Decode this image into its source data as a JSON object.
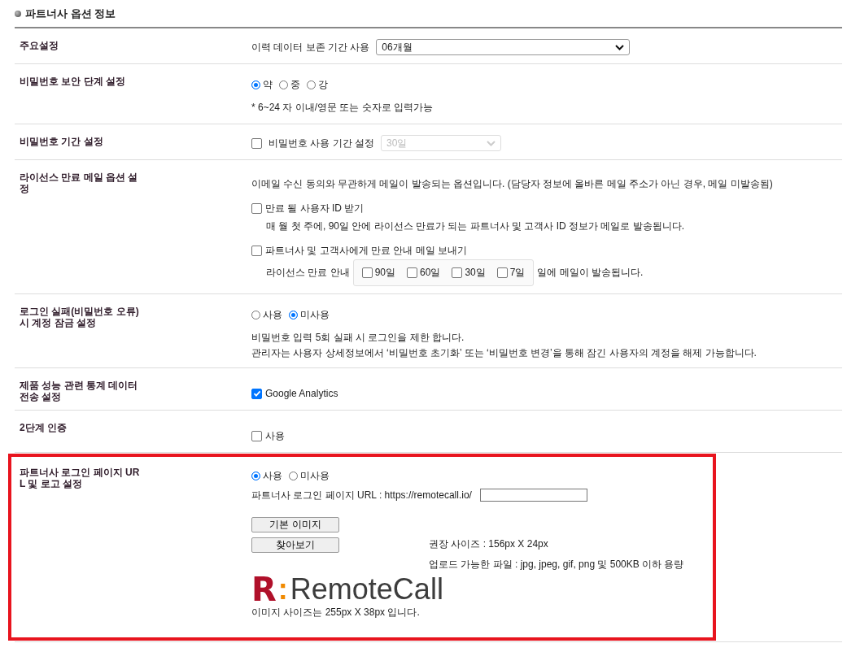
{
  "section_title": "파트너사 옵션 정보",
  "rows": [
    {
      "label": "주요설정",
      "highlighted": false,
      "items": [
        {
          "kind": "select",
          "text": "이력 데이터 보존 기간 사용",
          "value": "06개월",
          "disabled": false
        }
      ]
    },
    {
      "label": "비밀번호 보안 단계 설정",
      "highlighted": false,
      "items": [
        {
          "kind": "radios",
          "options": [
            {
              "label": "약",
              "selected": true
            },
            {
              "label": "중",
              "selected": false
            },
            {
              "label": "강",
              "selected": false
            }
          ]
        },
        {
          "kind": "note",
          "text": "* 6~24 자 이내/영문 또는 숫자로 입력가능"
        }
      ]
    },
    {
      "label": "비밀번호 기간 설정",
      "highlighted": false,
      "items": [
        {
          "kind": "check-select",
          "checked": false,
          "text": "비밀번호 사용 기간 설정",
          "value": "30일",
          "disabled": true
        }
      ]
    },
    {
      "label": "라이선스 만료 메일 옵션 설정",
      "highlighted": false,
      "items": [
        {
          "kind": "note",
          "text": "이메일 수신 동의와 무관하게 메일이 발송되는 옵션입니다. (담당자 정보에 올바른 메일 주소가 아닌 경우, 메일 미발송됨)"
        },
        {
          "kind": "check",
          "checked": false,
          "text": "만료 될 사용자 ID 받기"
        },
        {
          "kind": "subnote",
          "text": "매 월 첫 주에, 90일 안에 라이선스 만료가 되는 파트너사 및 고객사 ID 정보가 메일로 발송됩니다."
        },
        {
          "kind": "check",
          "checked": false,
          "text": "파트너사 및 고객사에게 만료 안내 메일 보내기"
        },
        {
          "kind": "day-checks",
          "text": "라이선스 만료 안내",
          "options": [
            {
              "label": "90일",
              "checked": false
            },
            {
              "label": "60일",
              "checked": false
            },
            {
              "label": "30일",
              "checked": false
            },
            {
              "label": "7일",
              "checked": false
            }
          ],
          "suffix": "일에 메일이 발송됩니다."
        }
      ]
    },
    {
      "label": "로그인 실패(비밀번호 오류) 시 계정 잠금 설정",
      "highlighted": false,
      "items": [
        {
          "kind": "radios",
          "options": [
            {
              "label": "사용",
              "selected": false
            },
            {
              "label": "미사용",
              "selected": true
            }
          ]
        },
        {
          "kind": "note",
          "text": "비밀번호 입력 5회 실패 시 로그인을 제한 합니다."
        },
        {
          "kind": "tightnote",
          "text": "관리자는 사용자 상세정보에서 ‘비밀번호 초기화’ 또는 ‘비밀번호 변경’을 통해 잠긴 사용자의 계정을 해제 가능합니다."
        }
      ]
    },
    {
      "label": "제품 성능 관련 통계 데이터 전송 설정",
      "highlighted": false,
      "items": [
        {
          "kind": "check",
          "checked": true,
          "text": "Google Analytics"
        }
      ]
    },
    {
      "label": "2단계 인증",
      "highlighted": false,
      "items": [
        {
          "kind": "check",
          "checked": false,
          "text": "사용"
        }
      ]
    },
    {
      "label": "파트너사 로그인 페이지 URL 및 로고 설정",
      "highlighted": true,
      "items": [
        {
          "kind": "radios",
          "options": [
            {
              "label": "사용",
              "selected": true
            },
            {
              "label": "미사용",
              "selected": false
            }
          ]
        },
        {
          "kind": "url-field",
          "text": "파트너사 로그인 페이지 URL : https://remotecall.io/"
        },
        {
          "kind": "button",
          "label": "기본 이미지"
        },
        {
          "kind": "button-notes",
          "label": "찾아보기",
          "notes": [
            "권장 사이즈 : 156px X 24px",
            "업로드 가능한 파일 : jpg, jpeg, gif, png 및 500KB 이하 용량"
          ]
        },
        {
          "kind": "logo",
          "mark": "R",
          "separator": ":",
          "name": "RemoteCall"
        },
        {
          "kind": "tightnote",
          "text": "이미지 사이즈는 255px X 38px 입니다."
        }
      ]
    }
  ]
}
